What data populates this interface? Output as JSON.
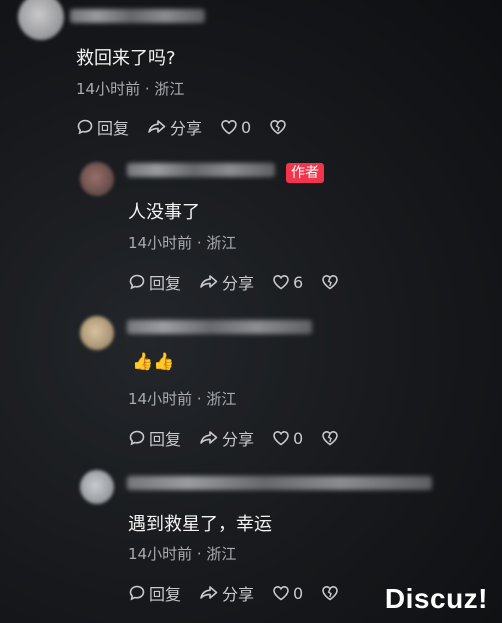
{
  "comments": [
    {
      "content": "救回来了吗?",
      "meta": "14小时前 · 浙江",
      "reply": "回复",
      "share": "分享",
      "likes": "0"
    },
    {
      "badge": "作者",
      "content": "人没事了",
      "meta": "14小时前 · 浙江",
      "reply": "回复",
      "share": "分享",
      "likes": "6"
    },
    {
      "content": "👍👍",
      "meta": "14小时前 · 浙江",
      "reply": "回复",
      "share": "分享",
      "likes": "0"
    },
    {
      "content": "遇到救星了，幸运",
      "meta": "14小时前 · 浙江",
      "reply": "回复",
      "share": "分享",
      "likes": "0"
    }
  ],
  "watermark": "Discuz!",
  "icons": {
    "reply": "speech-bubble-icon",
    "share": "share-arrow-icon",
    "like": "heart-icon",
    "dislike": "broken-heart-icon"
  }
}
